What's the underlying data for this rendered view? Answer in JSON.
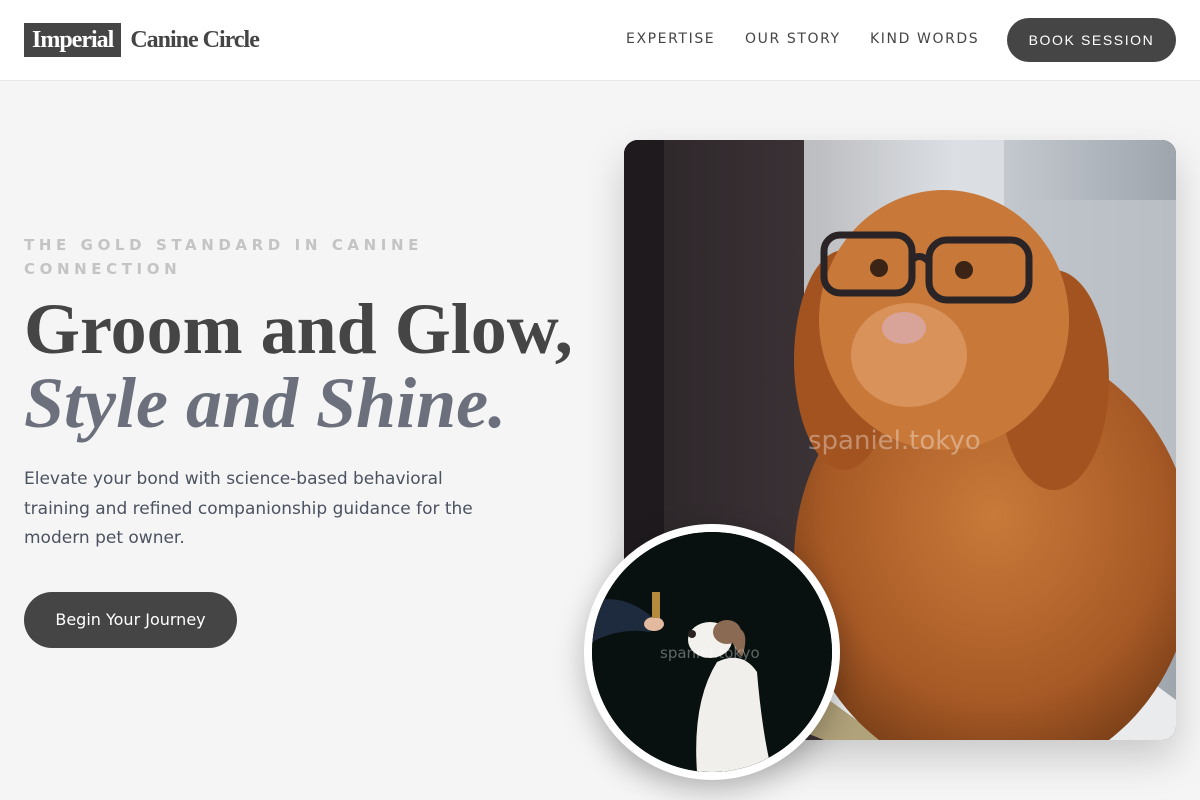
{
  "brand": {
    "box": "Imperial",
    "name": "Canine Circle"
  },
  "nav": {
    "items": [
      {
        "label": "EXPERTISE"
      },
      {
        "label": "OUR STORY"
      },
      {
        "label": "KIND WORDS"
      }
    ],
    "cta_label": "BOOK SESSION"
  },
  "hero": {
    "eyebrow": "THE GOLD STANDARD IN CANINE CONNECTION",
    "headline_line1": "Groom and Glow,",
    "headline_line2": "Style and Shine",
    "headline_dot": ".",
    "lede": "Elevate your bond with science-based behavioral training and refined companionship guidance for the modern pet owner.",
    "cta_label": "Begin Your Journey"
  },
  "images": {
    "main_watermark": "spaniel.tokyo",
    "small_watermark": "spaniel.tokyo"
  },
  "colors": {
    "primary": "#454545",
    "accent_italic": "#6b707c",
    "eyebrow": "#c4c4c4",
    "background": "#f5f5f5"
  }
}
